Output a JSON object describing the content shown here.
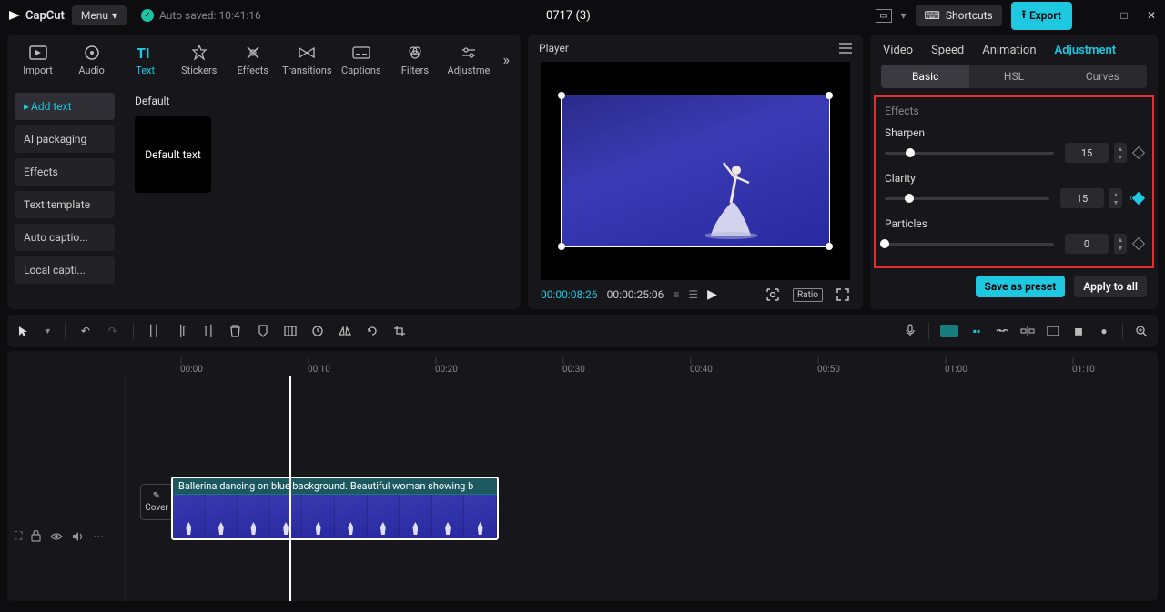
{
  "titlebar": {
    "logo_text": "CapCut",
    "menu_label": "Menu",
    "autosave_label": "Auto saved: 10:41:16",
    "project_title": "0717 (3)",
    "shortcuts_label": "Shortcuts",
    "export_label": "Export"
  },
  "left_tabs": {
    "import": "Import",
    "audio": "Audio",
    "text": "Text",
    "stickers": "Stickers",
    "effects": "Effects",
    "transitions": "Transitions",
    "captions": "Captions",
    "filters": "Filters",
    "adjustme": "Adjustme"
  },
  "side_items": {
    "add_text": "Add text",
    "ai_packaging": "AI packaging",
    "effects": "Effects",
    "text_template": "Text template",
    "auto_captions": "Auto captio...",
    "local_captions": "Local capti..."
  },
  "content": {
    "heading": "Default",
    "thumb_label": "Default text"
  },
  "player": {
    "title": "Player",
    "time_current": "00:00:08:26",
    "time_total": "00:00:25:06",
    "ratio_label": "Ratio"
  },
  "inspector": {
    "tabs": {
      "video": "Video",
      "speed": "Speed",
      "animation": "Animation",
      "adjustment": "Adjustment"
    },
    "subtabs": {
      "basic": "Basic",
      "hsl": "HSL",
      "curves": "Curves"
    },
    "section_title": "Effects",
    "sharpen_label": "Sharpen",
    "sharpen_value": "15",
    "clarity_label": "Clarity",
    "clarity_value": "15",
    "particles_label": "Particles",
    "particles_value": "0",
    "save_preset": "Save as preset",
    "apply_all": "Apply to all"
  },
  "timeline": {
    "marks": [
      "00:00",
      "00:10",
      "00:20",
      "00:30",
      "00:40",
      "00:50",
      "01:00",
      "01:10"
    ],
    "cover_label": "Cover",
    "clip_label": "Ballerina dancing on blue background. Beautiful woman showing b"
  }
}
